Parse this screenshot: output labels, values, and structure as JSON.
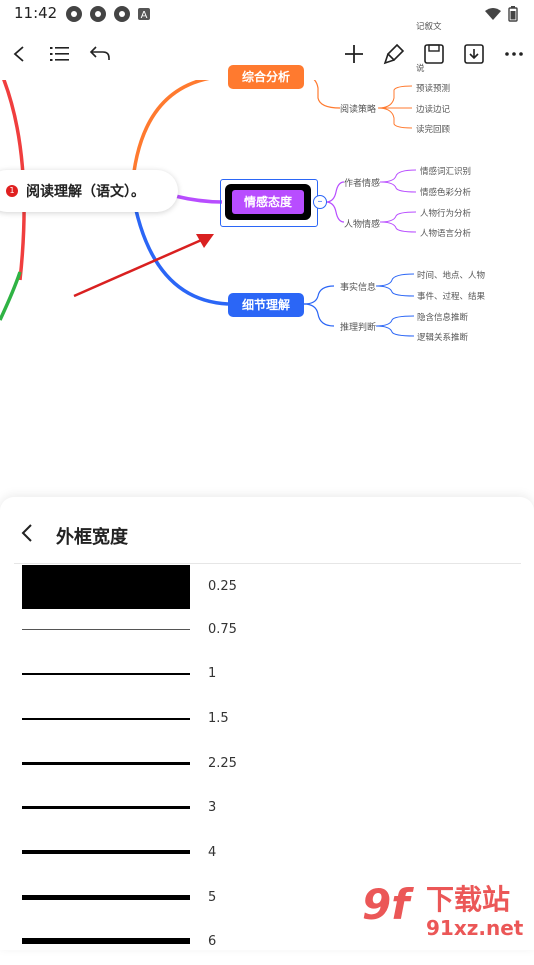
{
  "status_bar": {
    "time": "11:42",
    "notif_letter": "A"
  },
  "toolbar": {
    "icons": [
      "back-icon",
      "outline-list-icon",
      "undo-icon",
      "add-icon",
      "paint-brush-icon",
      "save-icon",
      "download-icon",
      "more-icon"
    ]
  },
  "mindmap": {
    "root": "阅读理解（语文）。",
    "root_badge": "1",
    "branches": [
      {
        "label": "综合分析",
        "color": "#FF7A2F",
        "children": [
          {
            "label": "",
            "leaves": [
              "记叙文",
              "说"
            ]
          },
          {
            "label": "阅读策略",
            "leaves": [
              "预读预测",
              "边读边记",
              "读完回顾"
            ]
          }
        ]
      },
      {
        "label": "情感态度",
        "color": "#B84DFF",
        "children": [
          {
            "label": "作者情感",
            "leaves": [
              "情感词汇识别",
              "情感色彩分析"
            ]
          },
          {
            "label": "人物情感",
            "leaves": [
              "人物行为分析",
              "人物语言分析"
            ]
          }
        ]
      },
      {
        "label": "细节理解",
        "color": "#2B66F6",
        "children": [
          {
            "label": "事实信息",
            "leaves": [
              "时间、地点、人物",
              "事件、过程、结果"
            ]
          },
          {
            "label": "推理判断",
            "leaves": [
              "隐含信息推断",
              "逻辑关系推断"
            ]
          }
        ]
      }
    ],
    "collapse_symbol": "–"
  },
  "sheet": {
    "title": "外框宽度",
    "widths": [
      "0.25",
      "0.75",
      "1",
      "1.5",
      "2.25",
      "3",
      "4",
      "5",
      "6"
    ]
  },
  "watermark": {
    "big_text": "下载站",
    "url": "91xz.net",
    "logo": "9f"
  }
}
